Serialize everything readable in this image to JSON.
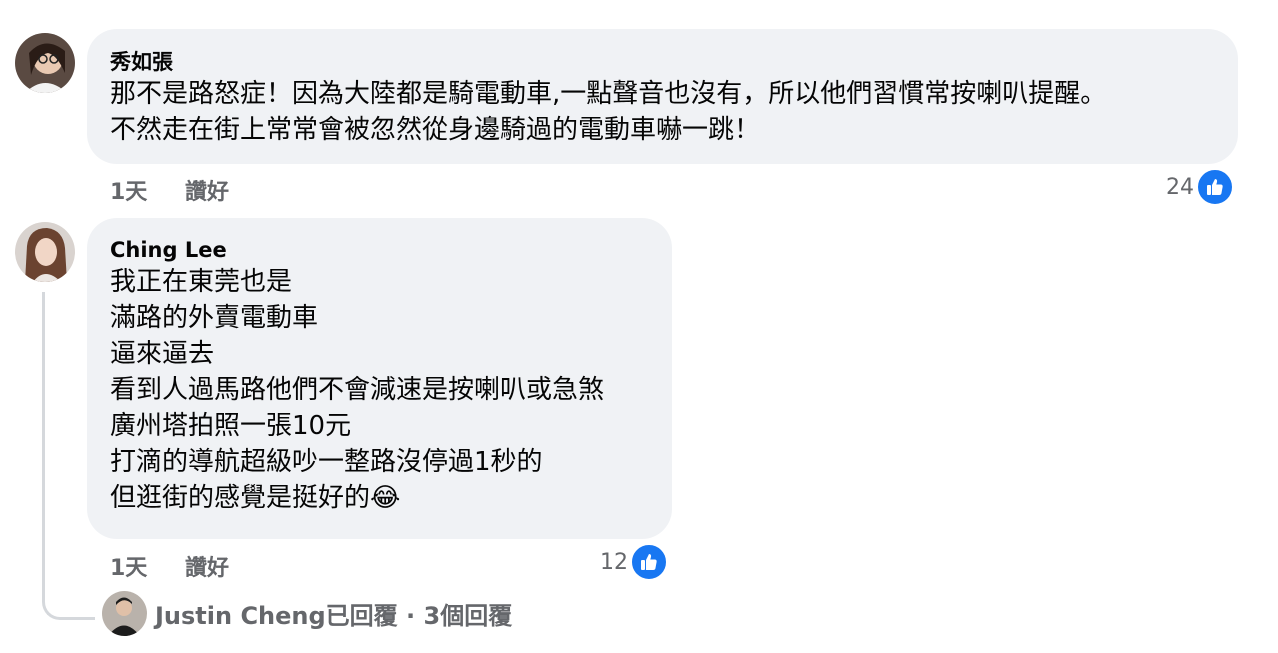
{
  "comments": [
    {
      "author": "秀如張",
      "lines": [
        "那不是路怒症！因為大陸都是騎電動車,一點聲音也沒有，所以他們習慣常按喇叭提醒。",
        "不然走在街上常常會被忽然從身邊騎過的電動車嚇一跳！"
      ],
      "time": "1天",
      "like_action": "讚好",
      "reaction_count": "24",
      "reaction_icon": "like-thumb-icon",
      "avatar_icon": "user-avatar-icon"
    },
    {
      "author": "Ching Lee",
      "lines": [
        "我正在東莞也是",
        "滿路的外賣電動車",
        "逼來逼去",
        "看到人過馬路他們不會減速是按喇叭或急煞",
        "廣州塔拍照一張10元",
        "打滴的導航超級吵一整路沒停過1秒的",
        "但逛街的感覺是挺好的"
      ],
      "emoji": "😂",
      "time": "1天",
      "like_action": "讚好",
      "reaction_count": "12",
      "reaction_icon": "like-thumb-icon",
      "avatar_icon": "user-avatar-icon"
    }
  ],
  "replies": {
    "text": "Justin Cheng已回覆 · 3個回覆",
    "avatar_icon": "user-avatar-icon"
  },
  "colors": {
    "bubble": "#f0f2f5",
    "like_blue": "#1877f2",
    "meta_gray": "#65676b",
    "text": "#050505"
  }
}
